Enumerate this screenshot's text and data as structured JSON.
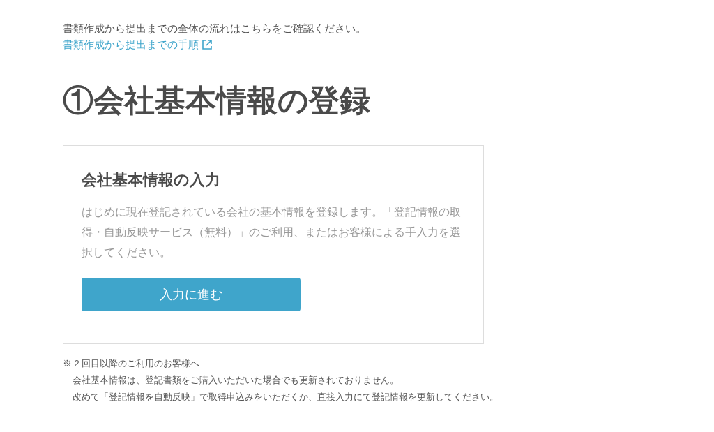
{
  "intro": {
    "text": "書類作成から提出までの全体の流れはこちらをご確認ください。",
    "link": "書類作成から提出までの手順"
  },
  "heading": "①会社基本情報の登録",
  "card": {
    "title": "会社基本情報の入力",
    "body": "はじめに現在登記されている会社の基本情報を登録します。「登記情報の取得・自動反映サービス（無料）」のご利用、またはお客様による手入力を選択してください。",
    "button": "入力に進む"
  },
  "notes": [
    "※ 2 回目以降のご利用のお客様へ",
    "会社基本情報は、登記書類をご購入いただいた場合でも更新されておりません。",
    "改めて「登記情報を自動反映」で取得申込みをいただくか、直接入力にて登記情報を更新してください。"
  ]
}
